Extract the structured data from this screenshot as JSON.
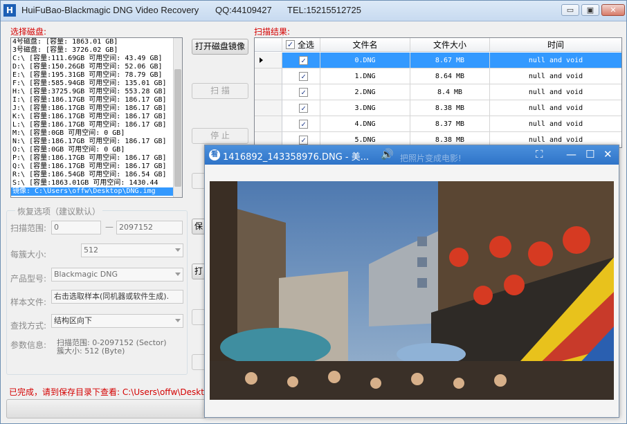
{
  "window": {
    "title_app": "HuiFuBao-Blackmagic DNG Video Recovery",
    "title_qq": "QQ:44109427",
    "title_tel": "TEL:15215512725",
    "controls": {
      "minimize": "▭",
      "restore": "▣",
      "close": "✕"
    }
  },
  "left": {
    "select_disk_label": "选择磁盘:",
    "disks": [
      "4号磁盘: [容量: 1863.01 GB]",
      "3号磁盘: [容量: 3726.02 GB]",
      "C:\\ [容量:111.69GB 可用空间: 43.49 GB]",
      "D:\\ [容量:150.26GB 可用空间: 52.06 GB]",
      "E:\\ [容量:195.31GB 可用空间: 78.79 GB]",
      "F:\\ [容量:585.94GB 可用空间: 135.01 GB]",
      "H:\\ [容量:3725.9GB 可用空间: 553.28 GB]",
      "I:\\ [容量:186.17GB 可用空间: 186.17 GB]",
      "J:\\ [容量:186.17GB 可用空间: 186.17 GB]",
      "K:\\ [容量:186.17GB 可用空间: 186.17 GB]",
      "L:\\ [容量:186.17GB 可用空间: 186.17 GB]",
      "M:\\ [容量:0GB 可用空间: 0 GB]",
      "N:\\ [容量:186.17GB 可用空间: 186.17 GB]",
      "O:\\ [容量:0GB 可用空间: 0 GB]",
      "P:\\ [容量:186.17GB 可用空间: 186.17 GB]",
      "Q:\\ [容量:186.17GB 可用空间: 186.17 GB]",
      "R:\\ [容量:186.54GB 可用空间: 186.54 GB]",
      "S:\\ [容量:1863.01GB 可用空间: 1430.44",
      "镜像: C:\\Users\\offw\\Desktop\\DNG.img"
    ],
    "selected_disk_index": 18
  },
  "buttons": {
    "open_image": "打开磁盘镜像",
    "scan": "扫 描",
    "stop": "停 止",
    "save_partial": "保",
    "open_partial": "打"
  },
  "options": {
    "group_title": "恢复选项（建议默认）",
    "scan_range_label": "扫描范围:",
    "scan_range_start": "0",
    "scan_range_dash": "—",
    "scan_range_end": "2097152",
    "cluster_label": "每簇大小:",
    "cluster_value": "512",
    "model_label": "产品型号:",
    "model_value": "Blackmagic DNG",
    "sample_label": "样本文件:",
    "sample_value": "右击选取样本(同机器或软件生成).",
    "search_label": "查找方式:",
    "search_value": "结构区向下",
    "param_label": "参数信息:",
    "param_line1": "扫描范围: 0-2097152 (Sector)",
    "param_line2": "簇大小: 512 (Byte)"
  },
  "status": {
    "done_text": "已完成，请到保存目录下查看: C:\\Users\\offw\\Deskt"
  },
  "results": {
    "label": "扫描结果:",
    "columns": {
      "select_all": "全选",
      "filename": "文件名",
      "filesize": "文件大小",
      "time": "时间"
    },
    "rows": [
      {
        "name": "0.DNG",
        "size": "8.67 MB",
        "time": "null and void",
        "checked": true,
        "selected": true
      },
      {
        "name": "1.DNG",
        "size": "8.64 MB",
        "time": "null and void",
        "checked": true,
        "selected": false
      },
      {
        "name": "2.DNG",
        "size": "8.4 MB",
        "time": "null and void",
        "checked": true,
        "selected": false
      },
      {
        "name": "3.DNG",
        "size": "8.38 MB",
        "time": "null and void",
        "checked": true,
        "selected": false
      },
      {
        "name": "4.DNG",
        "size": "8.37 MB",
        "time": "null and void",
        "checked": true,
        "selected": false
      },
      {
        "name": "5.DNG",
        "size": "8.38 MB",
        "time": "null and void",
        "checked": true,
        "selected": false
      }
    ]
  },
  "viewer": {
    "title": "1416892_143358976.DNG - 美...",
    "ghost_text": "把照片变成电影!",
    "icon_label": "看",
    "controls": {
      "volume": "🔊",
      "fit": "⛶",
      "minimize": "—",
      "maximize": "☐",
      "close": "✕"
    }
  },
  "colors": {
    "selection": "#3399ff",
    "red_text": "#d40000",
    "viewer_title": "#2f74c8"
  }
}
